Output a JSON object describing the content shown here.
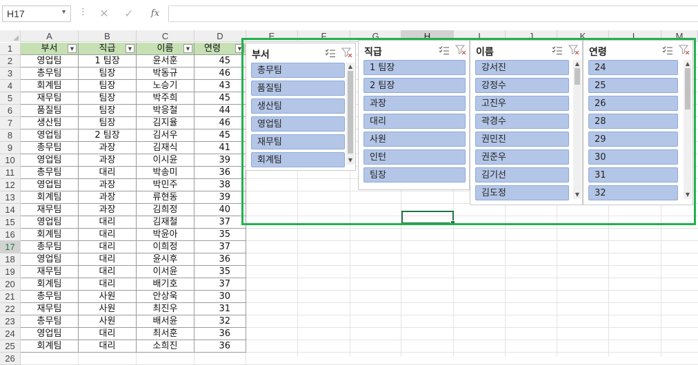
{
  "formula_bar": {
    "name_box": "H17",
    "cancel_icon": "✕",
    "enter_icon": "✓",
    "fx_label": "fx",
    "formula": ""
  },
  "columns": [
    "A",
    "B",
    "C",
    "D",
    "E",
    "F",
    "G",
    "H",
    "I",
    "J",
    "K",
    "L",
    "M"
  ],
  "selected_column": "H",
  "selected_row": "17",
  "table_headers": [
    "부서",
    "직급",
    "이름",
    "연령"
  ],
  "rows": [
    [
      "영업팀",
      "1 팀장",
      "윤서훈",
      "45"
    ],
    [
      "총무팀",
      "팀장",
      "박동규",
      "46"
    ],
    [
      "회계팀",
      "팀장",
      "노승기",
      "43"
    ],
    [
      "재무팀",
      "팀장",
      "박주희",
      "45"
    ],
    [
      "품질팀",
      "팀장",
      "박응철",
      "44"
    ],
    [
      "생산팀",
      "팀장",
      "김지율",
      "46"
    ],
    [
      "영업팀",
      "2 팀장",
      "김서우",
      "45"
    ],
    [
      "총무팀",
      "과장",
      "김재식",
      "41"
    ],
    [
      "영업팀",
      "과장",
      "이시윤",
      "39"
    ],
    [
      "총무팀",
      "대리",
      "박송미",
      "36"
    ],
    [
      "영업팀",
      "과장",
      "박민주",
      "38"
    ],
    [
      "회계팀",
      "과장",
      "류현동",
      "39"
    ],
    [
      "재무팀",
      "과장",
      "김희정",
      "40"
    ],
    [
      "영업팀",
      "대리",
      "김재철",
      "37"
    ],
    [
      "회계팀",
      "대리",
      "박윤아",
      "35"
    ],
    [
      "총무팀",
      "대리",
      "이희정",
      "37"
    ],
    [
      "영업팀",
      "대리",
      "윤시후",
      "36"
    ],
    [
      "재무팀",
      "대리",
      "이서윤",
      "35"
    ],
    [
      "회계팀",
      "대리",
      "배기호",
      "37"
    ],
    [
      "총무팀",
      "사원",
      "안상욱",
      "30"
    ],
    [
      "재무팀",
      "사원",
      "최진우",
      "31"
    ],
    [
      "총무팀",
      "사원",
      "배서윤",
      "32"
    ],
    [
      "영업팀",
      "대리",
      "최서훈",
      "36"
    ],
    [
      "회계팀",
      "대리",
      "소희진",
      "36"
    ]
  ],
  "row_numbers": [
    "1",
    "2",
    "3",
    "4",
    "5",
    "6",
    "7",
    "8",
    "9",
    "10",
    "11",
    "12",
    "13",
    "14",
    "15",
    "16",
    "17",
    "18",
    "19",
    "20",
    "21",
    "22",
    "23",
    "24",
    "25",
    "26"
  ],
  "slicers": [
    {
      "title": "부서",
      "items": [
        "총무팀",
        "품질팀",
        "생산팀",
        "영업팀",
        "재무팀",
        "회계팀"
      ]
    },
    {
      "title": "직급",
      "items": [
        "1 팀장",
        "2 팀장",
        "과장",
        "대리",
        "사원",
        "인턴",
        "팀장"
      ]
    },
    {
      "title": "이름",
      "items": [
        "강서진",
        "강정수",
        "고진우",
        "곽경수",
        "권민진",
        "권준우",
        "김기선",
        "김도정"
      ]
    },
    {
      "title": "연령",
      "items": [
        "24",
        "25",
        "26",
        "28",
        "29",
        "30",
        "31",
        "32"
      ]
    }
  ],
  "icons": {
    "multi_select": "multi-select-icon",
    "clear_filter": "clear-filter-icon",
    "dropdown": "chevron-down-icon"
  },
  "colors": {
    "header_fill": "#c6e0b4",
    "slicer_item": "#b4c6e7",
    "highlight_border": "#22b14c",
    "active_cell": "#217346"
  }
}
